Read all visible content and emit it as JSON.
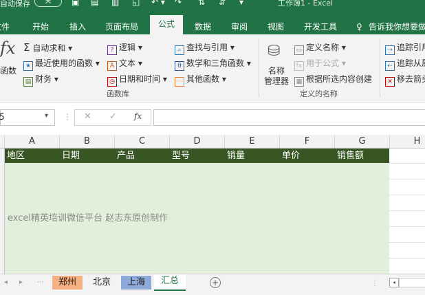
{
  "titlebar": {
    "autosave_label": "自动保存",
    "toggle_label": "关",
    "doc_title": "工作簿1 - Excel"
  },
  "tabs": [
    {
      "label": "文件"
    },
    {
      "label": "开始"
    },
    {
      "label": "插入"
    },
    {
      "label": "页面布局"
    },
    {
      "label": "公式",
      "active": true
    },
    {
      "label": "数据"
    },
    {
      "label": "审阅"
    },
    {
      "label": "视图"
    },
    {
      "label": "开发工具"
    },
    {
      "label": "告诉我你想要做什么"
    }
  ],
  "ribbon": {
    "insert_function_label": "函数",
    "fx_glyph": "fx",
    "library": {
      "autosum": "自动求和",
      "recent": "最近使用的函数",
      "financial": "财务",
      "logical": "逻辑",
      "text": "文本",
      "datetime": "日期和时间",
      "lookup": "查找与引用",
      "math": "数学和三角函数",
      "more": "其他函数",
      "group_label": "函数库"
    },
    "names": {
      "name_manager_line1": "名称",
      "name_manager_line2": "管理器",
      "define_name": "定义名称",
      "use_in_formula": "用于公式",
      "create_from_selection": "根据所选内容创建",
      "group_label": "定义的名称"
    },
    "audit": {
      "trace_precedents": "追踪引用",
      "trace_dependents": "追踪从属",
      "remove_arrows": "移去箭头"
    }
  },
  "formula_bar": {
    "namebox_value": "5",
    "cancel": "✕",
    "enter": "✓",
    "fx": "fx",
    "value": ""
  },
  "columns": [
    "A",
    "B",
    "C",
    "D",
    "E",
    "F",
    "G",
    "H"
  ],
  "table_header": [
    "地区",
    "日期",
    "产品",
    "型号",
    "销量",
    "单价",
    "销售额"
  ],
  "watermark": "excel精英培训微信平台 赵志东原创制作",
  "sheets": [
    {
      "label": "郑州",
      "color": "#f4b183"
    },
    {
      "label": "北京",
      "color": "#f3f3f3"
    },
    {
      "label": "上海",
      "color": "#8eaadb"
    },
    {
      "label": "汇总",
      "color": "#ffffff",
      "active": true
    }
  ],
  "colors": {
    "accent": "#217346",
    "header_fill": "#375623",
    "body_fill": "#e2efda"
  }
}
